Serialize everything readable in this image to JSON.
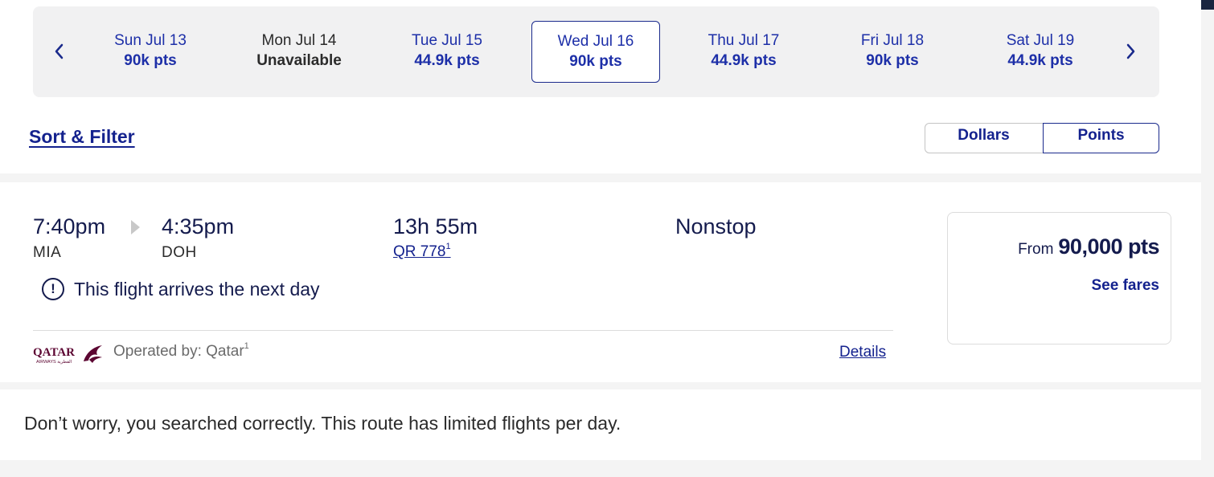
{
  "dates": {
    "prev_icon": "chevron-left-icon",
    "next_icon": "chevron-right-icon",
    "days": [
      {
        "label": "Sun Jul 13",
        "value": "90k pts",
        "state": "available"
      },
      {
        "label": "Mon Jul 14",
        "value": "Unavailable",
        "state": "unavailable"
      },
      {
        "label": "Tue Jul 15",
        "value": "44.9k pts",
        "state": "available"
      },
      {
        "label": "Wed Jul 16",
        "value": "90k pts",
        "state": "selected"
      },
      {
        "label": "Thu Jul 17",
        "value": "44.9k pts",
        "state": "available"
      },
      {
        "label": "Fri Jul 18",
        "value": "90k pts",
        "state": "available"
      },
      {
        "label": "Sat Jul 19",
        "value": "44.9k pts",
        "state": "available"
      }
    ]
  },
  "controls": {
    "sort_filter": "Sort & Filter",
    "currency_toggle": {
      "dollars": "Dollars",
      "points": "Points",
      "selected": "Points"
    }
  },
  "flight": {
    "depart_time": "7:40pm",
    "depart_code": "MIA",
    "arrive_time": "4:35pm",
    "arrive_code": "DOH",
    "duration": "13h 55m",
    "flight_number": "QR 778",
    "flight_footnote": "1",
    "stops": "Nonstop",
    "notice_icon": "exclamation-circle-icon",
    "notice": "This flight arrives the next day",
    "airline_logo": "QATAR",
    "airline_logo_sub": "AIRWAYS القطرية",
    "operated_by": "Operated by: Qatar",
    "operated_footnote": "1",
    "details_link": "Details",
    "fare_prefix": "From",
    "fare_value": "90,000 pts",
    "see_fares": "See fares"
  },
  "info": {
    "message": "Don’t worry, you searched correctly. This route has limited flights per day."
  },
  "colors": {
    "brand_navy": "#141b4d",
    "link_blue": "#14228e",
    "qatar_maroon": "#5c0632"
  }
}
